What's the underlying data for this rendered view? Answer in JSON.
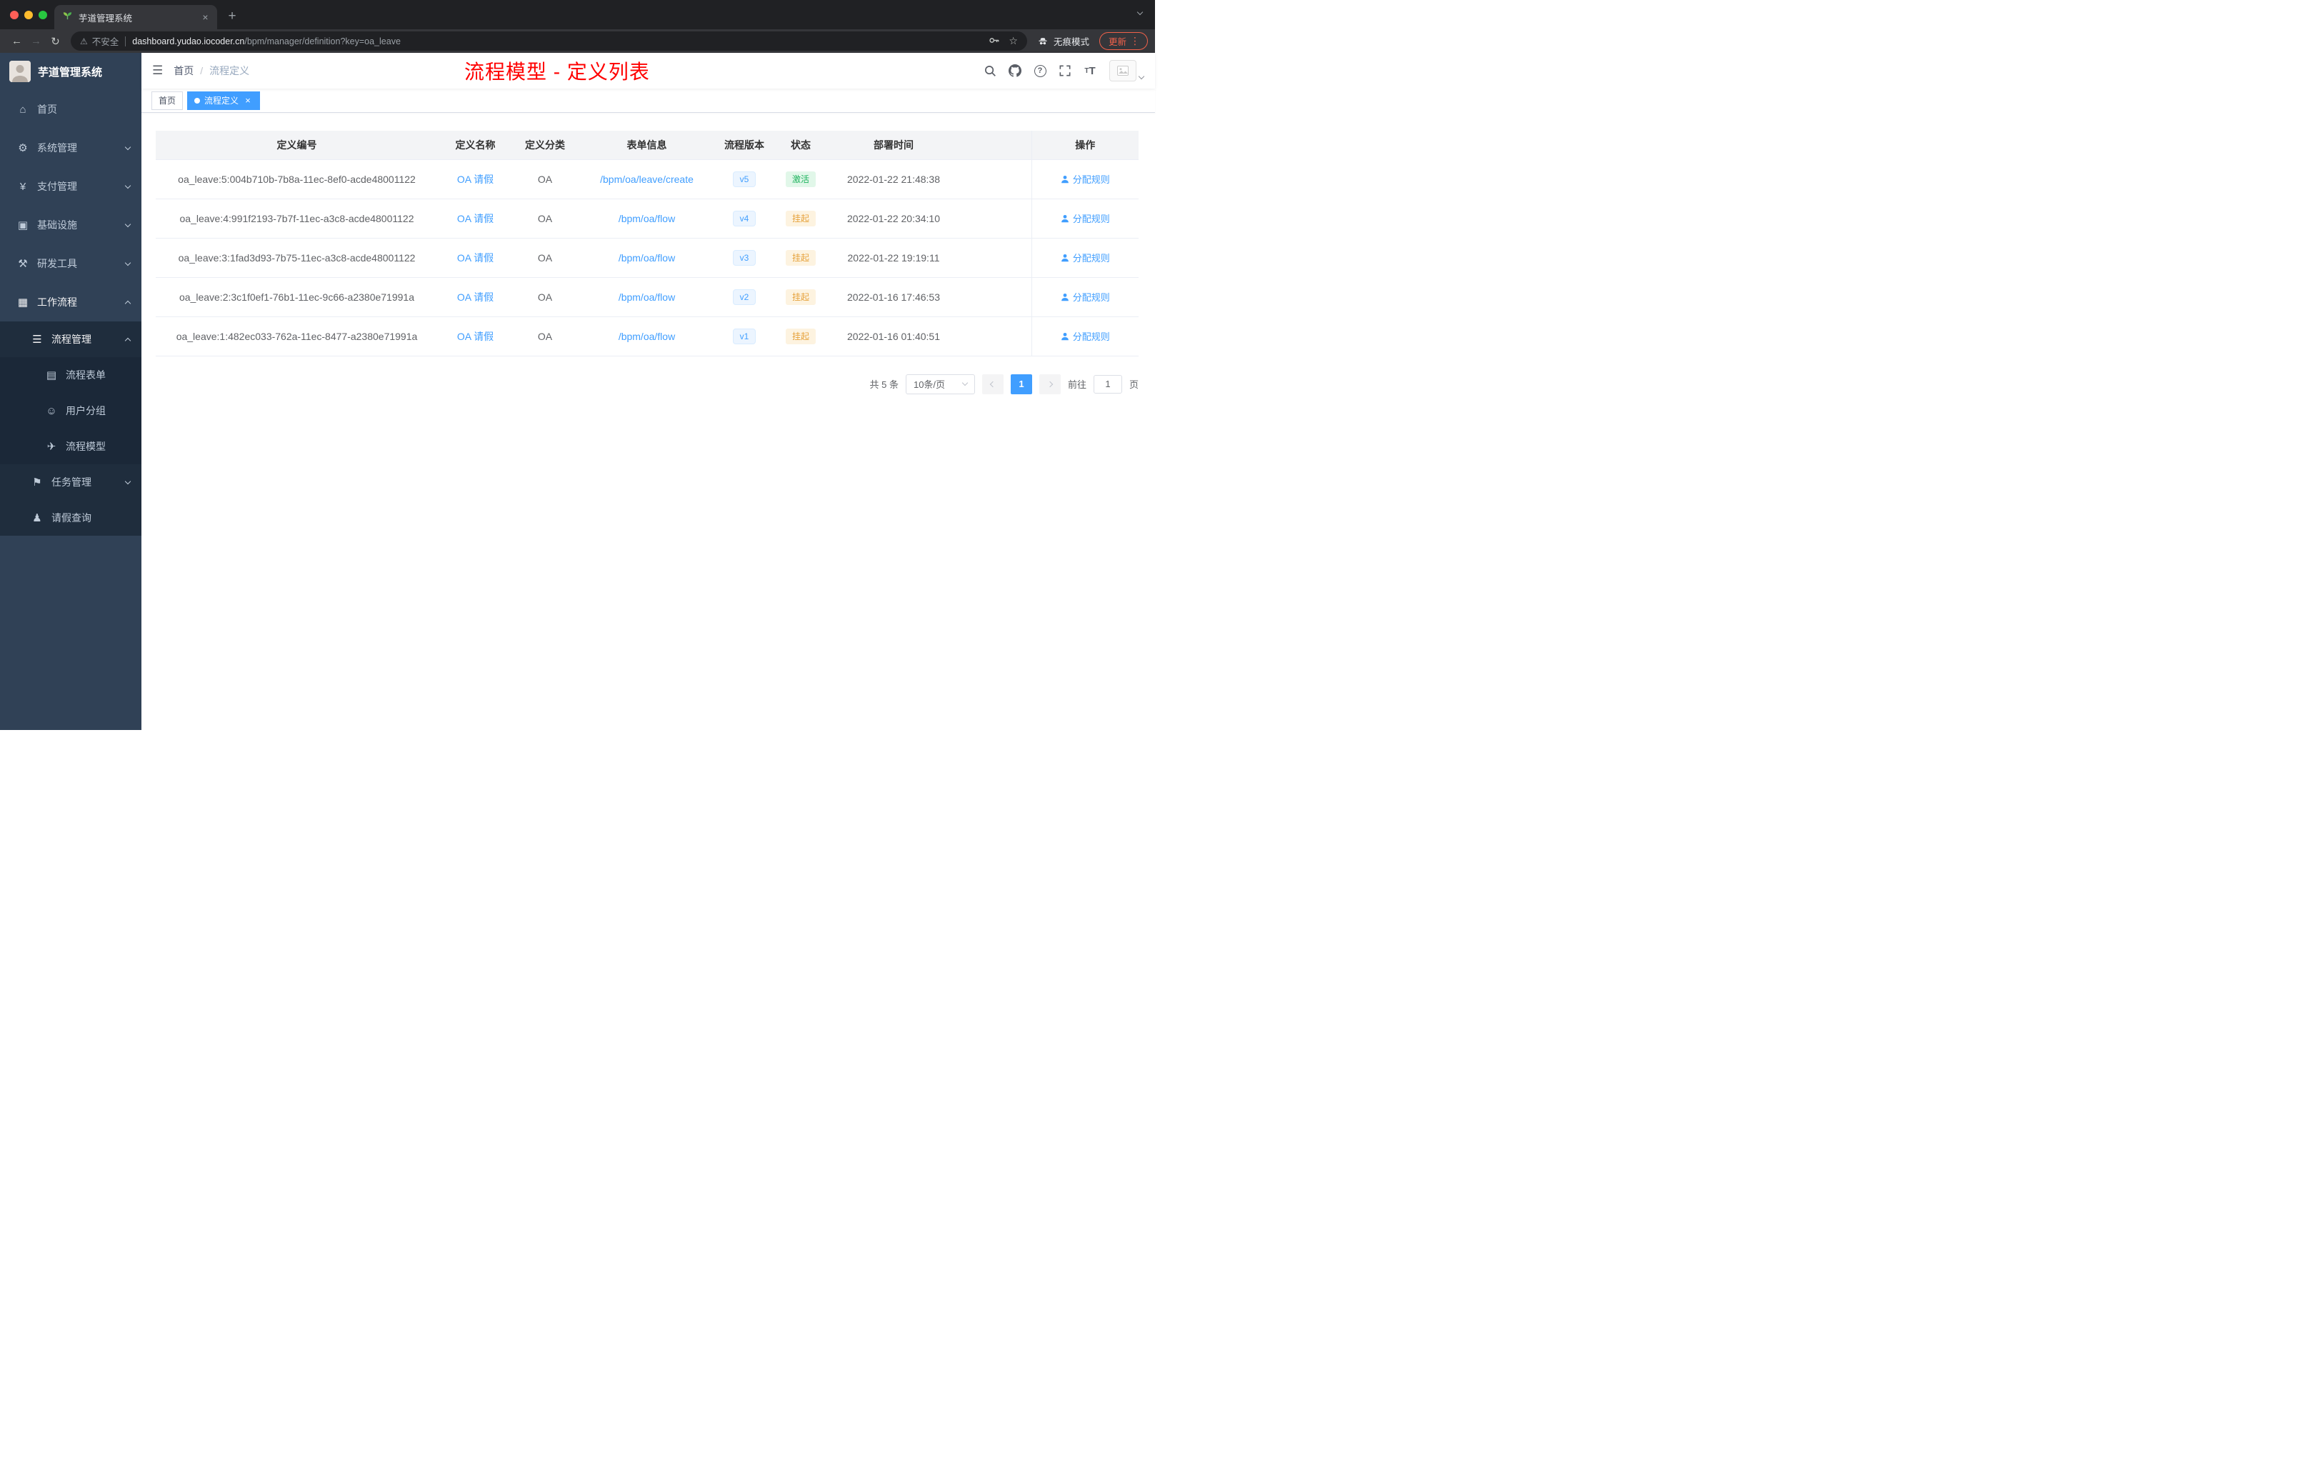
{
  "colors": {
    "accent": "#409eff",
    "annotation_red": "#ff0000",
    "success": "#1db35d",
    "warning": "#e6a23c"
  },
  "browser": {
    "tab_title": "芋道管理系统",
    "not_secure": "不安全",
    "url_host": "dashboard.yudao.iocoder.cn",
    "url_path": "/bpm/manager/definition?key=oa_leave",
    "incognito": "无痕模式",
    "update": "更新"
  },
  "sidebar": {
    "logo": "芋道管理系统",
    "menu": [
      {
        "label": "首页",
        "icon": "home-icon",
        "level": 1
      },
      {
        "label": "系统管理",
        "icon": "gear-icon",
        "level": 1,
        "chevron": "down"
      },
      {
        "label": "支付管理",
        "icon": "yen-icon",
        "level": 1,
        "chevron": "down"
      },
      {
        "label": "基础设施",
        "icon": "infrastructure-icon",
        "level": 1,
        "chevron": "down"
      },
      {
        "label": "研发工具",
        "icon": "tools-icon",
        "level": 1,
        "chevron": "down"
      },
      {
        "label": "工作流程",
        "icon": "workflow-icon",
        "level": 1,
        "chevron": "up",
        "active": true
      },
      {
        "label": "流程管理",
        "icon": "list-icon",
        "level": 2,
        "chevron": "up",
        "active": true
      },
      {
        "label": "流程表单",
        "icon": "form-icon",
        "level": 3
      },
      {
        "label": "用户分组",
        "icon": "user-group-icon",
        "level": 3
      },
      {
        "label": "流程模型",
        "icon": "paper-plane-icon",
        "level": 3
      },
      {
        "label": "任务管理",
        "icon": "flag-icon",
        "level": 2,
        "chevron": "down"
      },
      {
        "label": "请假查询",
        "icon": "person-icon",
        "level": 2
      }
    ]
  },
  "header": {
    "breadcrumb": [
      "首页",
      "流程定义"
    ],
    "breadcrumb_separator": "/",
    "annotation": "流程模型 - 定义列表"
  },
  "tags": [
    {
      "label": "首页",
      "active": false
    },
    {
      "label": "流程定义",
      "active": true,
      "closable": true
    }
  ],
  "table": {
    "columns": [
      "定义编号",
      "定义名称",
      "定义分类",
      "表单信息",
      "流程版本",
      "状态",
      "部署时间",
      "操作"
    ],
    "rows": [
      {
        "id": "oa_leave:5:004b710b-7b8a-11ec-8ef0-acde48001122",
        "name": "OA 请假",
        "category": "OA",
        "form": "/bpm/oa/leave/create",
        "version": "v5",
        "status": "激活",
        "status_type": "success",
        "time": "2022-01-22 21:48:38",
        "action": "分配规则"
      },
      {
        "id": "oa_leave:4:991f2193-7b7f-11ec-a3c8-acde48001122",
        "name": "OA 请假",
        "category": "OA",
        "form": "/bpm/oa/flow",
        "version": "v4",
        "status": "挂起",
        "status_type": "warning",
        "time": "2022-01-22 20:34:10",
        "action": "分配规则"
      },
      {
        "id": "oa_leave:3:1fad3d93-7b75-11ec-a3c8-acde48001122",
        "name": "OA 请假",
        "category": "OA",
        "form": "/bpm/oa/flow",
        "version": "v3",
        "status": "挂起",
        "status_type": "warning",
        "time": "2022-01-22 19:19:11",
        "action": "分配规则"
      },
      {
        "id": "oa_leave:2:3c1f0ef1-76b1-11ec-9c66-a2380e71991a",
        "name": "OA 请假",
        "category": "OA",
        "form": "/bpm/oa/flow",
        "version": "v2",
        "status": "挂起",
        "status_type": "warning",
        "time": "2022-01-16 17:46:53",
        "action": "分配规则"
      },
      {
        "id": "oa_leave:1:482ec033-762a-11ec-8477-a2380e71991a",
        "name": "OA 请假",
        "category": "OA",
        "form": "/bpm/oa/flow",
        "version": "v1",
        "status": "挂起",
        "status_type": "warning",
        "time": "2022-01-16 01:40:51",
        "action": "分配规则"
      }
    ]
  },
  "pagination": {
    "total": "共 5 条",
    "page_size": "10条/页",
    "current": "1",
    "goto_label": "前往",
    "goto_value": "1",
    "page_unit": "页"
  }
}
